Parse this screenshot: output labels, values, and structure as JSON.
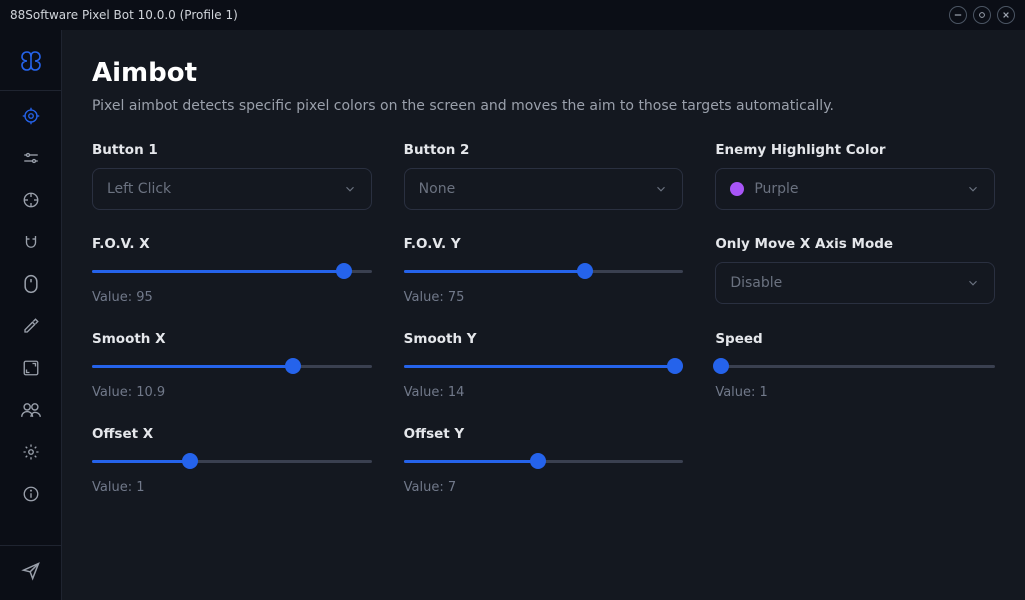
{
  "window": {
    "title": "88Software Pixel Bot 10.0.0 (Profile 1)"
  },
  "page": {
    "title": "Aimbot",
    "subtitle": "Pixel aimbot detects specific pixel colors on the screen and moves the aim to those targets automatically."
  },
  "button1": {
    "label": "Button 1",
    "value": "Left Click"
  },
  "button2": {
    "label": "Button 2",
    "value": "None"
  },
  "enemyColor": {
    "label": "Enemy Highlight Color",
    "value": "Purple",
    "swatch": "#a855f7"
  },
  "fovx": {
    "label": "F.O.V. X",
    "valueLabel": "Value: 95",
    "pct": 90
  },
  "fovy": {
    "label": "F.O.V. Y",
    "valueLabel": "Value: 75",
    "pct": 65
  },
  "xaxis": {
    "label": "Only Move X Axis Mode",
    "value": "Disable"
  },
  "smoothx": {
    "label": "Smooth X",
    "valueLabel": "Value: 10.9",
    "pct": 72
  },
  "smoothy": {
    "label": "Smooth Y",
    "valueLabel": "Value: 14",
    "pct": 97
  },
  "speed": {
    "label": "Speed",
    "valueLabel": "Value: 1",
    "pct": 2
  },
  "offsetx": {
    "label": "Offset X",
    "valueLabel": "Value: 1",
    "pct": 35
  },
  "offsety": {
    "label": "Offset Y",
    "valueLabel": "Value: 7",
    "pct": 48
  }
}
